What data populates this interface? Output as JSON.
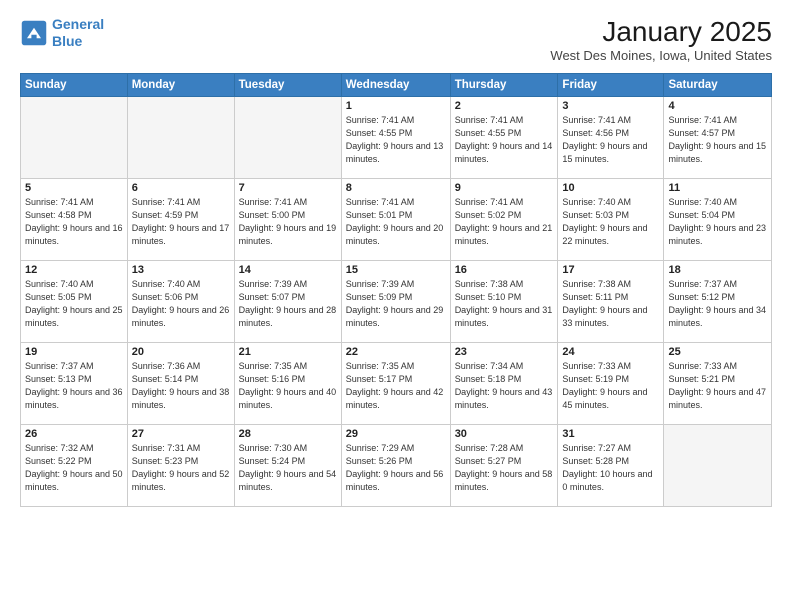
{
  "header": {
    "logo_line1": "General",
    "logo_line2": "Blue",
    "month": "January 2025",
    "location": "West Des Moines, Iowa, United States"
  },
  "weekdays": [
    "Sunday",
    "Monday",
    "Tuesday",
    "Wednesday",
    "Thursday",
    "Friday",
    "Saturday"
  ],
  "weeks": [
    [
      {
        "day": "",
        "info": ""
      },
      {
        "day": "",
        "info": ""
      },
      {
        "day": "",
        "info": ""
      },
      {
        "day": "1",
        "info": "Sunrise: 7:41 AM\nSunset: 4:55 PM\nDaylight: 9 hours and 13 minutes."
      },
      {
        "day": "2",
        "info": "Sunrise: 7:41 AM\nSunset: 4:55 PM\nDaylight: 9 hours and 14 minutes."
      },
      {
        "day": "3",
        "info": "Sunrise: 7:41 AM\nSunset: 4:56 PM\nDaylight: 9 hours and 15 minutes."
      },
      {
        "day": "4",
        "info": "Sunrise: 7:41 AM\nSunset: 4:57 PM\nDaylight: 9 hours and 15 minutes."
      }
    ],
    [
      {
        "day": "5",
        "info": "Sunrise: 7:41 AM\nSunset: 4:58 PM\nDaylight: 9 hours and 16 minutes."
      },
      {
        "day": "6",
        "info": "Sunrise: 7:41 AM\nSunset: 4:59 PM\nDaylight: 9 hours and 17 minutes."
      },
      {
        "day": "7",
        "info": "Sunrise: 7:41 AM\nSunset: 5:00 PM\nDaylight: 9 hours and 19 minutes."
      },
      {
        "day": "8",
        "info": "Sunrise: 7:41 AM\nSunset: 5:01 PM\nDaylight: 9 hours and 20 minutes."
      },
      {
        "day": "9",
        "info": "Sunrise: 7:41 AM\nSunset: 5:02 PM\nDaylight: 9 hours and 21 minutes."
      },
      {
        "day": "10",
        "info": "Sunrise: 7:40 AM\nSunset: 5:03 PM\nDaylight: 9 hours and 22 minutes."
      },
      {
        "day": "11",
        "info": "Sunrise: 7:40 AM\nSunset: 5:04 PM\nDaylight: 9 hours and 23 minutes."
      }
    ],
    [
      {
        "day": "12",
        "info": "Sunrise: 7:40 AM\nSunset: 5:05 PM\nDaylight: 9 hours and 25 minutes."
      },
      {
        "day": "13",
        "info": "Sunrise: 7:40 AM\nSunset: 5:06 PM\nDaylight: 9 hours and 26 minutes."
      },
      {
        "day": "14",
        "info": "Sunrise: 7:39 AM\nSunset: 5:07 PM\nDaylight: 9 hours and 28 minutes."
      },
      {
        "day": "15",
        "info": "Sunrise: 7:39 AM\nSunset: 5:09 PM\nDaylight: 9 hours and 29 minutes."
      },
      {
        "day": "16",
        "info": "Sunrise: 7:38 AM\nSunset: 5:10 PM\nDaylight: 9 hours and 31 minutes."
      },
      {
        "day": "17",
        "info": "Sunrise: 7:38 AM\nSunset: 5:11 PM\nDaylight: 9 hours and 33 minutes."
      },
      {
        "day": "18",
        "info": "Sunrise: 7:37 AM\nSunset: 5:12 PM\nDaylight: 9 hours and 34 minutes."
      }
    ],
    [
      {
        "day": "19",
        "info": "Sunrise: 7:37 AM\nSunset: 5:13 PM\nDaylight: 9 hours and 36 minutes."
      },
      {
        "day": "20",
        "info": "Sunrise: 7:36 AM\nSunset: 5:14 PM\nDaylight: 9 hours and 38 minutes."
      },
      {
        "day": "21",
        "info": "Sunrise: 7:35 AM\nSunset: 5:16 PM\nDaylight: 9 hours and 40 minutes."
      },
      {
        "day": "22",
        "info": "Sunrise: 7:35 AM\nSunset: 5:17 PM\nDaylight: 9 hours and 42 minutes."
      },
      {
        "day": "23",
        "info": "Sunrise: 7:34 AM\nSunset: 5:18 PM\nDaylight: 9 hours and 43 minutes."
      },
      {
        "day": "24",
        "info": "Sunrise: 7:33 AM\nSunset: 5:19 PM\nDaylight: 9 hours and 45 minutes."
      },
      {
        "day": "25",
        "info": "Sunrise: 7:33 AM\nSunset: 5:21 PM\nDaylight: 9 hours and 47 minutes."
      }
    ],
    [
      {
        "day": "26",
        "info": "Sunrise: 7:32 AM\nSunset: 5:22 PM\nDaylight: 9 hours and 50 minutes."
      },
      {
        "day": "27",
        "info": "Sunrise: 7:31 AM\nSunset: 5:23 PM\nDaylight: 9 hours and 52 minutes."
      },
      {
        "day": "28",
        "info": "Sunrise: 7:30 AM\nSunset: 5:24 PM\nDaylight: 9 hours and 54 minutes."
      },
      {
        "day": "29",
        "info": "Sunrise: 7:29 AM\nSunset: 5:26 PM\nDaylight: 9 hours and 56 minutes."
      },
      {
        "day": "30",
        "info": "Sunrise: 7:28 AM\nSunset: 5:27 PM\nDaylight: 9 hours and 58 minutes."
      },
      {
        "day": "31",
        "info": "Sunrise: 7:27 AM\nSunset: 5:28 PM\nDaylight: 10 hours and 0 minutes."
      },
      {
        "day": "",
        "info": ""
      }
    ]
  ]
}
